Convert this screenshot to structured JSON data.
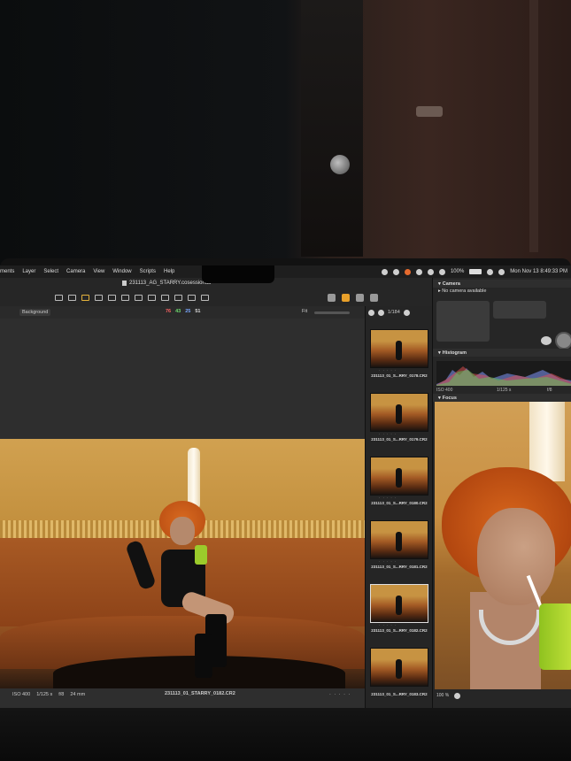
{
  "menubar": {
    "items": [
      "ments",
      "Layer",
      "Select",
      "Camera",
      "View",
      "Window",
      "Scripts",
      "Help"
    ],
    "battery": "100%",
    "clock": "Mon Nov 13  8:49:33 PM"
  },
  "window": {
    "document_title": "231113_AG_STARRY.cosessiondb"
  },
  "viewer": {
    "variant_label": "Background",
    "adjust_values": [
      "76",
      "43",
      "25",
      "51"
    ],
    "zoom_label": "Fit",
    "iso": "ISO 400",
    "shutter": "1/125 s",
    "aperture": "f/8",
    "focal": "24 mm",
    "filename": "231113_01_STARRY_0182.CR2",
    "rating_dots": "· · · · ·"
  },
  "browser": {
    "count": "1/184",
    "thumbnails": [
      {
        "name": "231113_01_S...RRY_0178.CR2",
        "rating": "· · · · ·"
      },
      {
        "name": "231113_01_S...RRY_0179.CR2",
        "rating": "· · · · ·"
      },
      {
        "name": "231113_01_S...RRY_0180.CR2",
        "rating": "· · · · ·"
      },
      {
        "name": "231113_01_S...RRY_0181.CR2",
        "rating": "· · · · ·"
      },
      {
        "name": "231113_01_S...RRY_0182.CR2",
        "rating": "· · · · ·"
      },
      {
        "name": "231113_01_S...RRY_0183.CR2",
        "rating": ""
      }
    ]
  },
  "inspector": {
    "camera_title": "Camera",
    "camera_status": "No camera available",
    "histogram_title": "Histogram",
    "histo_iso": "ISO 400",
    "histo_shutter": "1/125 s",
    "histo_aperture": "f/8",
    "focus_title": "Focus",
    "focus_zoom": "100 %"
  }
}
